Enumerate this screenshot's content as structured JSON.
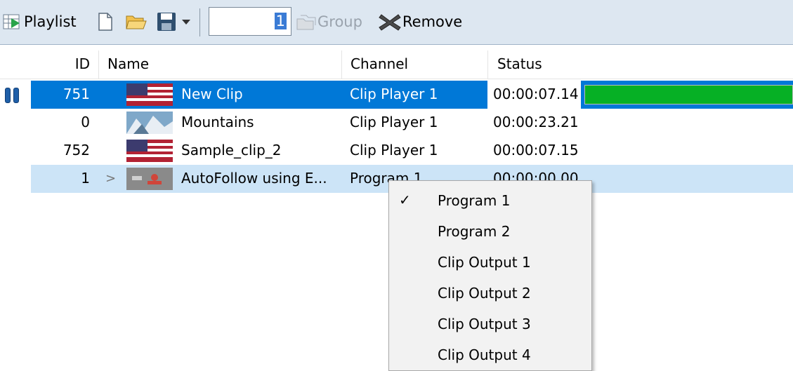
{
  "toolbar": {
    "playlist_label": "Playlist",
    "id_value": "1",
    "group_label": "Group",
    "remove_label": "Remove"
  },
  "columns": {
    "id": "ID",
    "name": "Name",
    "channel": "Channel",
    "status": "Status"
  },
  "rows": [
    {
      "id": "751",
      "name": "New Clip",
      "channel": "Clip Player 1",
      "status": "00:00:07.14",
      "progress": 1.0
    },
    {
      "id": "0",
      "name": "Mountains",
      "channel": "Clip Player 1",
      "status": "00:00:23.21"
    },
    {
      "id": "752",
      "name": "Sample_clip_2",
      "channel": "Clip Player 1",
      "status": "00:00:07.15"
    },
    {
      "id": "1",
      "name": "AutoFollow using E...",
      "channel": "Program 1",
      "status": "00:00:00.00"
    }
  ],
  "menu": {
    "items": [
      {
        "label": "Program 1",
        "checked": true
      },
      {
        "label": "Program 2"
      },
      {
        "label": "Clip Output 1"
      },
      {
        "label": "Clip Output 2"
      },
      {
        "label": "Clip Output 3"
      },
      {
        "label": "Clip Output 4"
      }
    ],
    "check_mark": "✓"
  },
  "colors": {
    "selection": "#0078d7",
    "hover": "#cce4f7",
    "progress": "#06b025"
  }
}
